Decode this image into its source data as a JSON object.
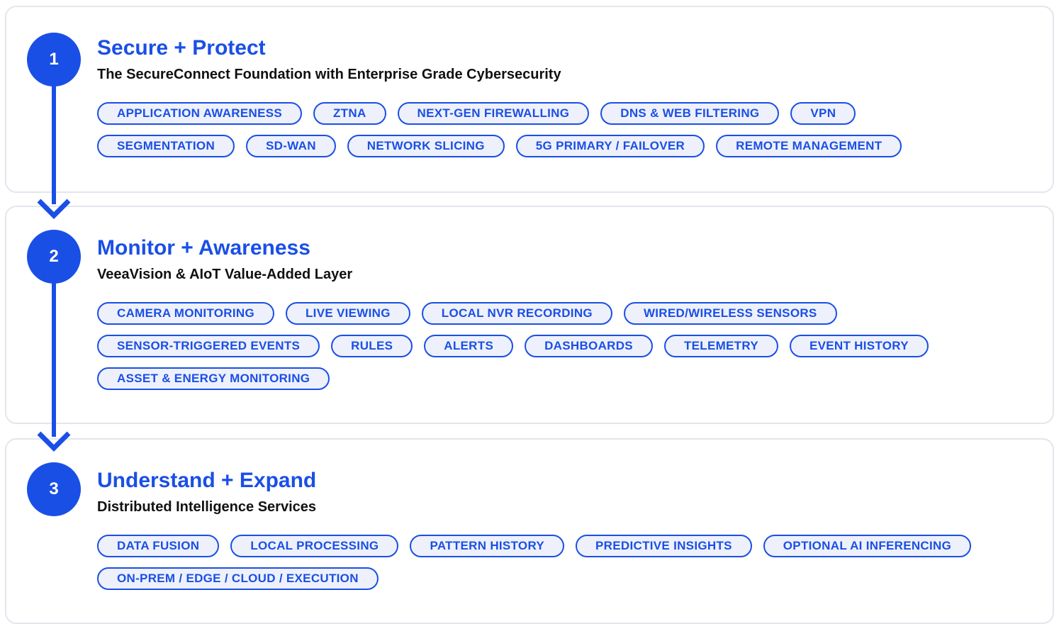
{
  "colors": {
    "accent": "#1a4fe6",
    "pill_bg": "#eef1fb",
    "card_border": "#e3e6ec"
  },
  "steps": [
    {
      "number": "1",
      "title": "Secure + Protect",
      "subtitle": "The SecureConnect Foundation with Enterprise Grade Cybersecurity",
      "tags": [
        "APPLICATION AWARENESS",
        "ZTNA",
        "NEXT-GEN FIREWALLING",
        "DNS & WEB FILTERING",
        "VPN",
        "SEGMENTATION",
        "SD-WAN",
        "NETWORK SLICING",
        "5G PRIMARY / FAILOVER",
        "REMOTE MANAGEMENT"
      ]
    },
    {
      "number": "2",
      "title": "Monitor + Awareness",
      "subtitle": "VeeaVision & AIoT Value-Added Layer",
      "tags": [
        "CAMERA MONITORING",
        "LIVE VIEWING",
        "LOCAL NVR RECORDING",
        "WIRED/WIRELESS SENSORS",
        "SENSOR-TRIGGERED EVENTS",
        "RULES",
        "ALERTS",
        "DASHBOARDS",
        "TELEMETRY",
        "EVENT HISTORY",
        "ASSET & ENERGY MONITORING"
      ]
    },
    {
      "number": "3",
      "title": "Understand + Expand",
      "subtitle": "Distributed Intelligence Services",
      "tags": [
        "DATA FUSION",
        "LOCAL PROCESSING",
        "PATTERN HISTORY",
        "PREDICTIVE INSIGHTS",
        "OPTIONAL AI INFERENCING",
        "ON-PREM / EDGE / CLOUD / EXECUTION"
      ]
    }
  ]
}
